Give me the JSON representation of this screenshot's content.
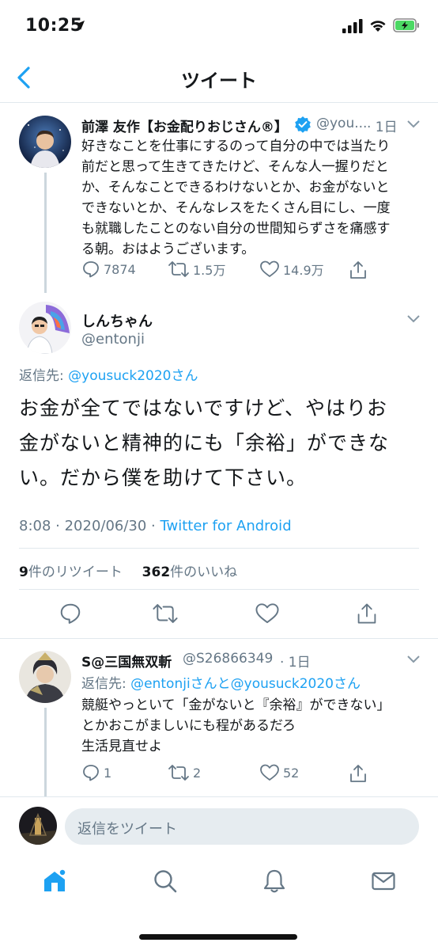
{
  "status_bar": {
    "time": "10:25"
  },
  "header": {
    "title": "ツイート"
  },
  "parent_tweet": {
    "name": "前澤 友作【お金配りおじさん®】",
    "handle": "@you...",
    "time": "· 1日",
    "lines": [
      "好きなことを仕事にするのって自分の中では当たり",
      "前だと思って生きてきたけど、そんな人一握りだと",
      "か、そんなことできるわけないとか、お金がないと",
      "できないとか、そんなレスをたくさん目にし、一度",
      "も就職したことのない自分の世間知らずさを痛感す",
      "る朝。おはようございます。"
    ],
    "replies": "7874",
    "retweets": "1.5万",
    "likes": "14.9万"
  },
  "main_tweet": {
    "name": "しんちゃん",
    "handle": "@entonji",
    "reply_prefix": "返信先: ",
    "reply_mention": "@yousuck2020さん",
    "lines": [
      "お金が全てではないですけど、やはりお",
      "金がないと精神的にも「余裕」ができな",
      "い。だから僕を助けて下さい。"
    ],
    "timestamp": "8:08 · 2020/06/30 · ",
    "source": "Twitter for Android",
    "retweet_count": "9",
    "retweet_label": "件のリツイート",
    "like_count": "362",
    "like_label": "件のいいね"
  },
  "reply_tweet": {
    "name": "S@三国無双斬",
    "handle": "@S26866349",
    "time": "· 1日",
    "reply_prefix": "返信先: ",
    "reply_mention": "@entonjiさんと@yousuck2020さん",
    "lines": [
      "競艇やっといて「金がないと『余裕』ができない」",
      "とかおこがましいにも程があるだろ",
      "生活見直せよ"
    ],
    "replies": "1",
    "retweets": "2",
    "likes": "52"
  },
  "compose": {
    "placeholder": "返信をツイート"
  },
  "tabs": [
    "home-icon",
    "search-icon",
    "notifications-icon",
    "messages-icon"
  ],
  "colors": {
    "accent": "#1da1f2",
    "muted": "#657786",
    "text": "#14171a",
    "battery": "#4cd964"
  }
}
